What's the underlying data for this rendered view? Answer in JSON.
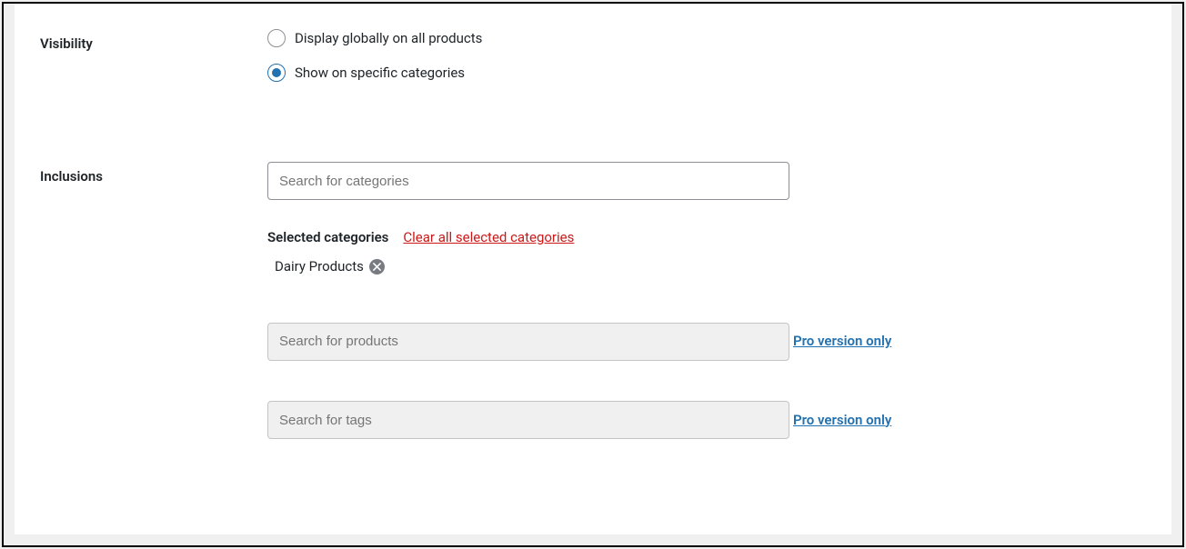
{
  "visibility": {
    "label": "Visibility",
    "options": [
      {
        "label": "Display globally on all products",
        "checked": false
      },
      {
        "label": "Show on specific categories",
        "checked": true
      }
    ]
  },
  "inclusions": {
    "label": "Inclusions",
    "categories_search_placeholder": "Search for categories",
    "selected_label": "Selected categories",
    "clear_link": "Clear all selected categories",
    "selected_items": [
      {
        "name": "Dairy Products"
      }
    ],
    "products_search_placeholder": "Search for products",
    "products_pro_link": "Pro version only",
    "tags_search_placeholder": "Search for tags",
    "tags_pro_link": "Pro version only"
  }
}
